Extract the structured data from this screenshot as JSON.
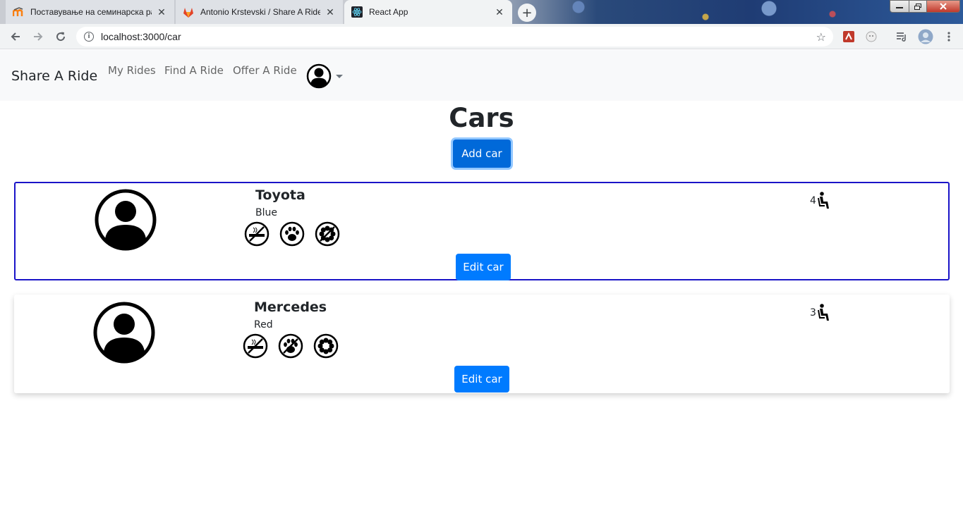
{
  "browser": {
    "tabs": [
      {
        "title": "Поставување на семинарска ра",
        "favicon": "moodle-icon",
        "active": false
      },
      {
        "title": "Antonio Krstevski / Share A Ride",
        "favicon": "gitlab-icon",
        "active": false
      },
      {
        "title": "React App",
        "favicon": "react-icon",
        "active": true
      }
    ],
    "close_glyph": "✕",
    "new_tab_glyph": "+",
    "url": "localhost:3000/car"
  },
  "navbar": {
    "brand": "Share A Ride",
    "links": [
      "My Rides",
      "Find A Ride",
      "Offer A Ride"
    ],
    "user_icon": "user-circle-icon"
  },
  "page": {
    "title": "Cars",
    "add_button": "Add car"
  },
  "cars": [
    {
      "name": "Toyota",
      "color": "Blue",
      "seats": "4",
      "edit_label": "Edit car",
      "selected": true,
      "preferences": [
        "no-smoking-icon",
        "pet-paw-icon",
        "no-flower-icon"
      ]
    },
    {
      "name": "Mercedes",
      "color": "Red",
      "seats": "3",
      "edit_label": "Edit car",
      "selected": false,
      "preferences": [
        "no-smoking-icon",
        "pet-paw-icon",
        "flower-icon"
      ]
    }
  ],
  "colors": {
    "primary": "#007bff",
    "primary_active": "#0069d9",
    "selected_border": "#1a14c8",
    "navbar_bg": "#f8f9fa"
  }
}
